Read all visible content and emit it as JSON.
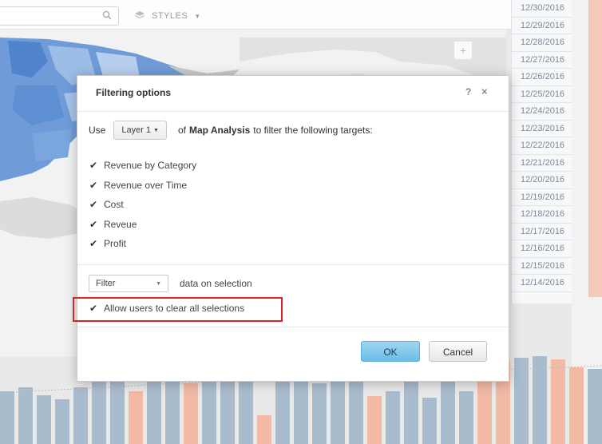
{
  "toolbar": {
    "styles_label": "STYLES",
    "search_icon": "magnifier-icon",
    "layers_icon": "layers-icon",
    "zoom_label": "+"
  },
  "dates": [
    "12/30/2016",
    "12/29/2016",
    "12/28/2016",
    "12/27/2016",
    "12/26/2016",
    "12/25/2016",
    "12/24/2016",
    "12/23/2016",
    "12/22/2016",
    "12/21/2016",
    "12/20/2016",
    "12/19/2016",
    "12/18/2016",
    "12/17/2016",
    "12/16/2016",
    "12/15/2016",
    "12/14/2016"
  ],
  "dialog": {
    "title": "Filtering options",
    "help_label": "?",
    "close_label": "×",
    "use_label": "Use",
    "layer_value": "Layer 1",
    "of_label": "of",
    "source_name": "Map Analysis",
    "targets_suffix": "to filter the following targets:",
    "targets": [
      {
        "label": "Revenue by Category",
        "checked": true
      },
      {
        "label": "Revenue over Time",
        "checked": true
      },
      {
        "label": "Cost",
        "checked": true
      },
      {
        "label": "Reveue",
        "checked": true
      },
      {
        "label": "Profit",
        "checked": true
      }
    ],
    "filter_value": "Filter",
    "filter_suffix": "data on selection",
    "allow_clear_label": "Allow users to clear all selections",
    "allow_clear_checked": true,
    "ok_label": "OK",
    "cancel_label": "Cancel"
  },
  "colors": {
    "bar_blue": "#a9bccd",
    "bar_salmon": "#f2b9a5",
    "highlight": "#d6242a",
    "ok_button": "#7cc5ea"
  }
}
